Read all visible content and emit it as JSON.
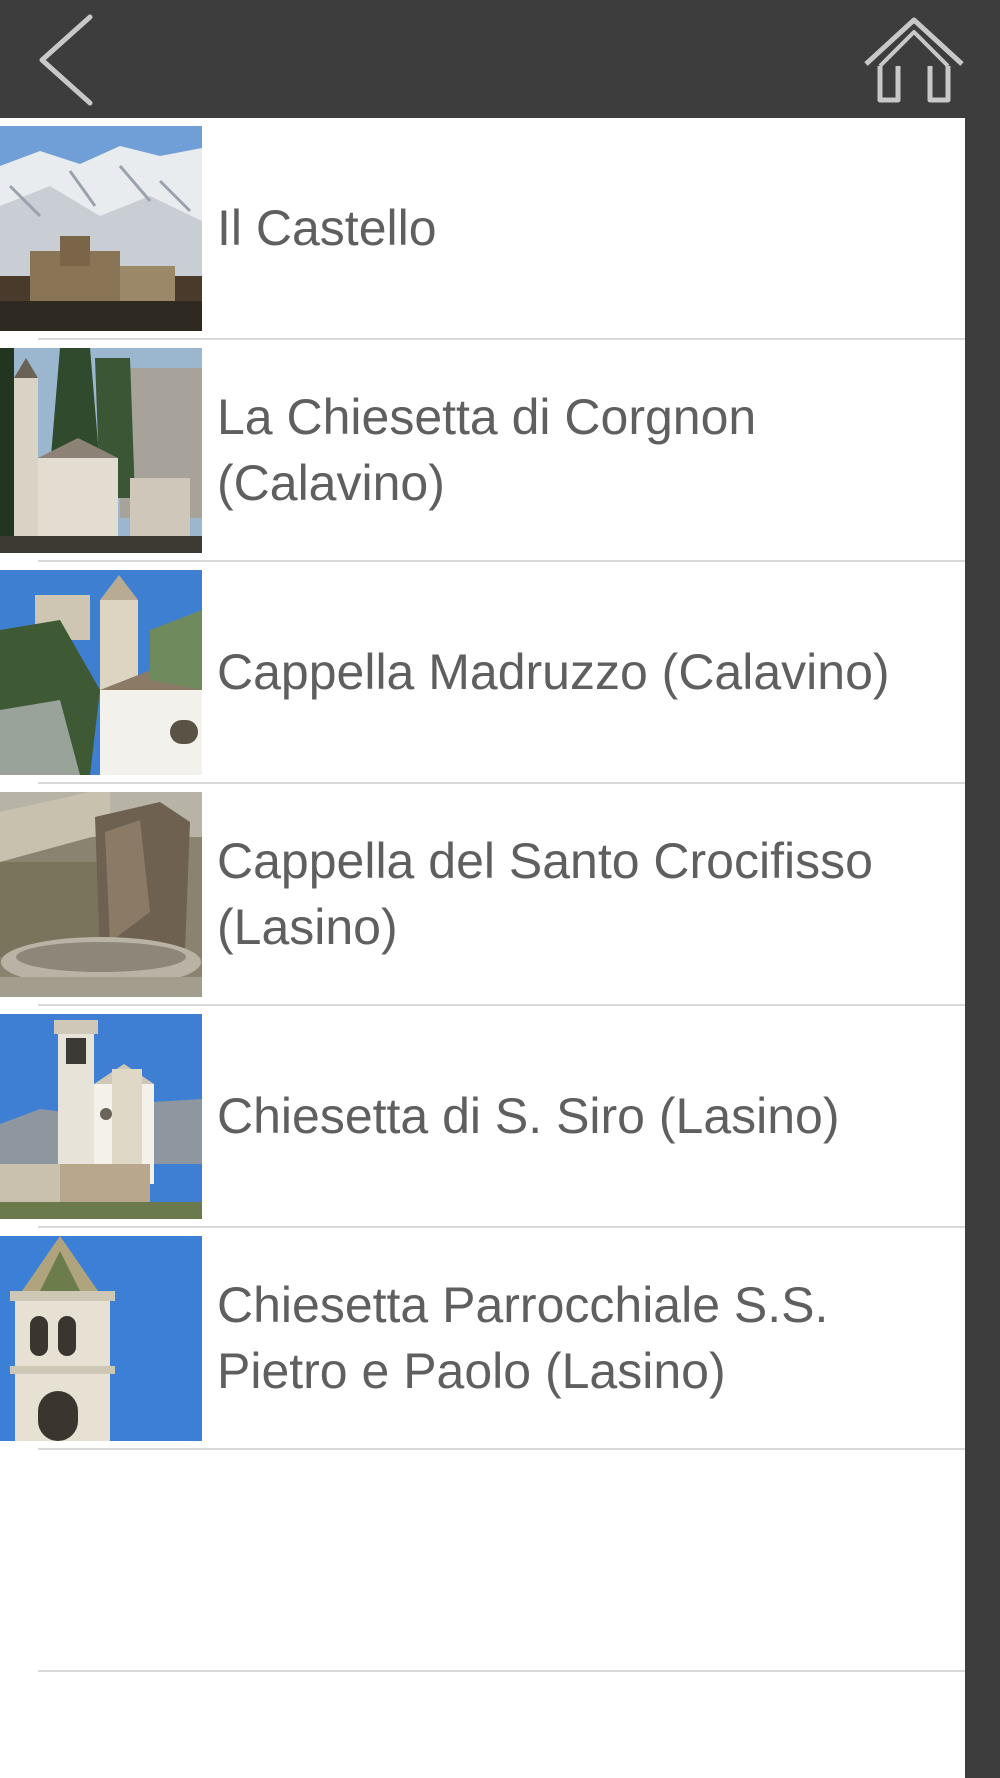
{
  "header": {
    "back_icon": "chevron-left-icon",
    "home_icon": "home-icon"
  },
  "items": [
    {
      "label": "Il Castello",
      "thumb": "castle-mountain-photo"
    },
    {
      "label": "La Chiesetta di Corgnon (Calavino)",
      "thumb": "bell-tower-trees-photo"
    },
    {
      "label": "Cappella Madruzzo (Calavino)",
      "thumb": "castle-chapel-photo"
    },
    {
      "label": "Cappella del Santo Crocifisso (Lasino)",
      "thumb": "stone-fountain-photo"
    },
    {
      "label": "Chiesetta di S. Siro (Lasino)",
      "thumb": "white-church-photo"
    },
    {
      "label": "Chiesetta Parrocchiale S.S. Pietro e Paolo (Lasino)",
      "thumb": "belfry-sky-photo"
    }
  ],
  "colors": {
    "bar": "#3d3d3d",
    "list_bg": "#ffffff",
    "text": "#5f5f5f",
    "separator": "#d9d9d9"
  }
}
